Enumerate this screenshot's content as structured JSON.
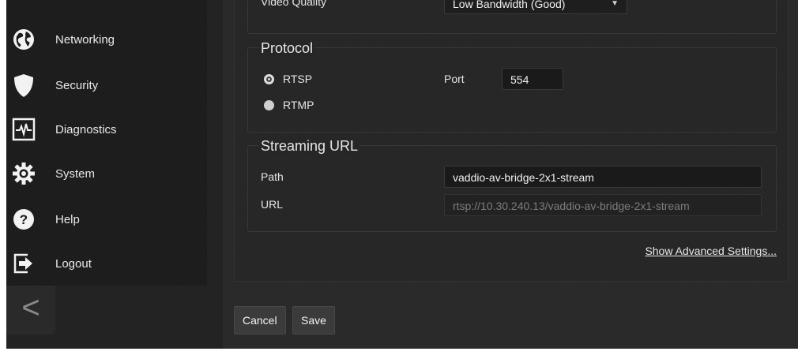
{
  "sidebar": {
    "items": [
      {
        "label": "Networking",
        "icon": "globe-icon"
      },
      {
        "label": "Security",
        "icon": "shield-icon"
      },
      {
        "label": "Diagnostics",
        "icon": "pulse-icon"
      },
      {
        "label": "System",
        "icon": "gear-icon"
      },
      {
        "label": "Help",
        "icon": "help-icon"
      },
      {
        "label": "Logout",
        "icon": "logout-icon"
      }
    ],
    "collapse_glyph": "<"
  },
  "video_quality": {
    "label": "Video Quality",
    "value": "Low Bandwidth (Good)"
  },
  "protocol": {
    "legend": "Protocol",
    "options": [
      {
        "label": "RTSP",
        "selected": true
      },
      {
        "label": "RTMP",
        "selected": false
      }
    ],
    "port_label": "Port",
    "port_value": "554"
  },
  "streaming_url": {
    "legend": "Streaming URL",
    "path_label": "Path",
    "path_value": "vaddio-av-bridge-2x1-stream",
    "url_label": "URL",
    "url_value": "rtsp://10.30.240.13/vaddio-av-bridge-2x1-stream"
  },
  "advanced_link": "Show Advanced Settings...",
  "buttons": {
    "cancel": "Cancel",
    "save": "Save"
  }
}
